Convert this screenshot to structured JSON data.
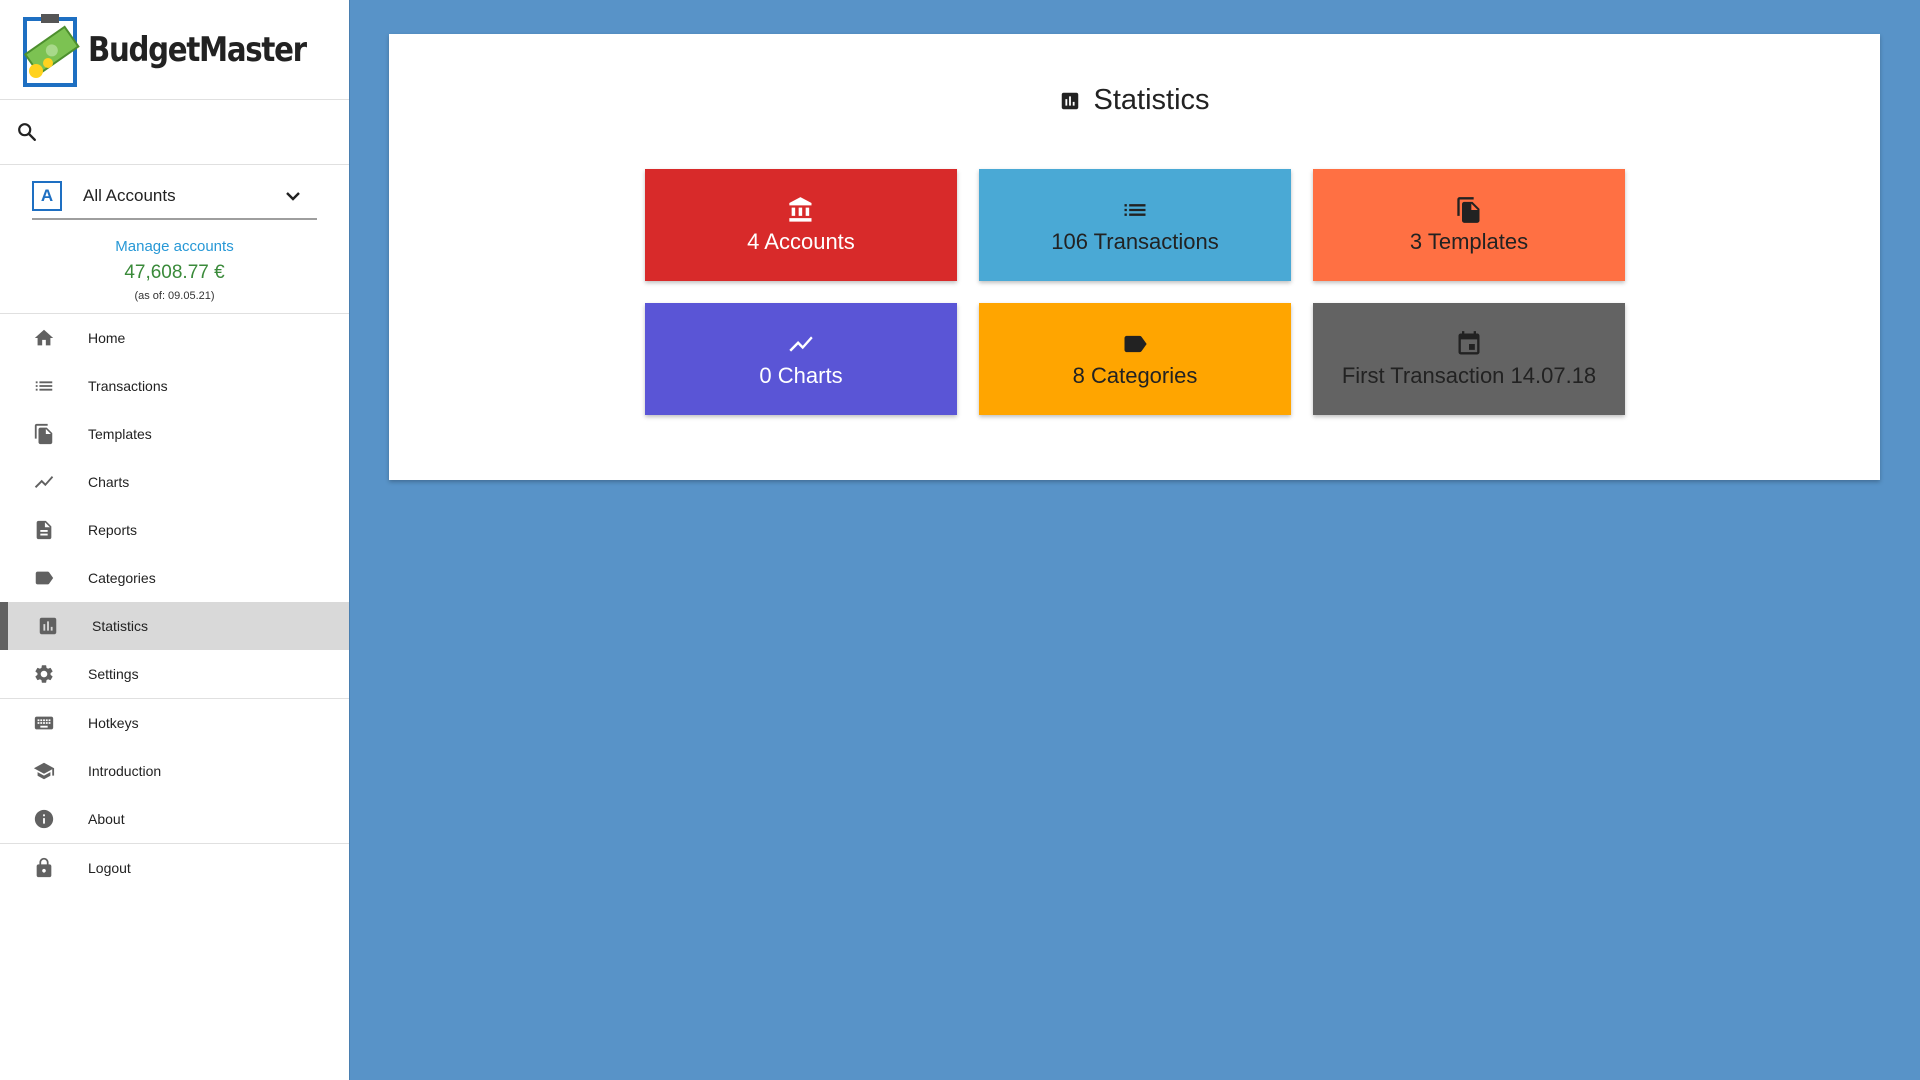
{
  "app": {
    "name": "BudgetMaster"
  },
  "search": {
    "placeholder": ""
  },
  "account": {
    "badge": "A",
    "selected": "All Accounts",
    "manage_link": "Manage accounts",
    "balance": "47,608.77 €",
    "as_of": "(as of: 09.05.21)"
  },
  "sidebar": {
    "items": [
      {
        "label": "Home",
        "icon": "home-icon"
      },
      {
        "label": "Transactions",
        "icon": "list-icon"
      },
      {
        "label": "Templates",
        "icon": "file-copy-icon"
      },
      {
        "label": "Charts",
        "icon": "line-chart-icon"
      },
      {
        "label": "Reports",
        "icon": "report-icon"
      },
      {
        "label": "Categories",
        "icon": "label-icon"
      },
      {
        "label": "Statistics",
        "icon": "bar-chart-icon",
        "active": true
      },
      {
        "label": "Settings",
        "icon": "gear-icon"
      },
      {
        "label": "Hotkeys",
        "icon": "keyboard-icon"
      },
      {
        "label": "Introduction",
        "icon": "school-icon"
      },
      {
        "label": "About",
        "icon": "info-icon"
      },
      {
        "label": "Logout",
        "icon": "lock-icon"
      }
    ]
  },
  "main": {
    "title": "Statistics",
    "tiles": [
      {
        "label": "4 Accounts",
        "icon": "bank-icon",
        "color": "#d82a2a",
        "text_color": "#ffffff"
      },
      {
        "label": "106 Transactions",
        "icon": "list-icon",
        "color": "#4aa9d5",
        "text_color": "#222222"
      },
      {
        "label": "3 Templates",
        "icon": "file-copy-icon",
        "color": "#ff7043",
        "text_color": "#222222"
      },
      {
        "label": "0 Charts",
        "icon": "line-chart-icon",
        "color": "#5a55d6",
        "text_color": "#ffffff"
      },
      {
        "label": "8 Categories",
        "icon": "label-icon",
        "color": "#ffa500",
        "text_color": "#222222"
      },
      {
        "label": "First Transaction 14.07.18",
        "icon": "calendar-icon",
        "color": "#636363",
        "text_color": "#222222"
      }
    ]
  },
  "colors": {
    "background": "#5893c8",
    "link": "#2798d6",
    "balance": "#3a8a3a",
    "account_badge": "#1e6fc2"
  }
}
